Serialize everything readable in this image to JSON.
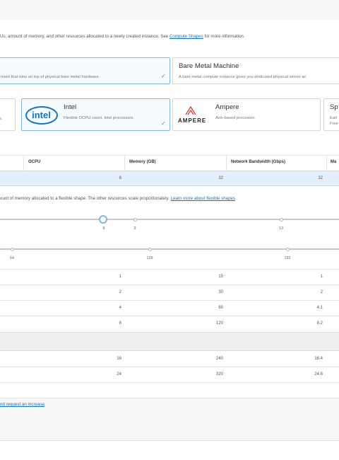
{
  "intro": {
    "text": "Us, amount of memory, and other resources allocated to a newly created instance. See ",
    "link": "Compute Shapes",
    "suffix": " for more information."
  },
  "instance_types": [
    {
      "desc": "ment that runs on top of physical bare metal hardware.",
      "selected": true
    },
    {
      "title": "Bare Metal Machine",
      "desc": "A bare metal compute instance gives you dedicated physical server ac",
      "selected": false
    }
  ],
  "processors": {
    "left_fragment": "s.",
    "intel": {
      "logo": "intel",
      "title": "Intel",
      "desc": "Flexible OCPU count. Intel processors.",
      "selected": true
    },
    "ampere": {
      "logo": "AMPERE",
      "title": "Ampere",
      "desc": "Arm-based processor."
    },
    "spark": {
      "title": "Sp",
      "desc1": "Earl",
      "desc2": "Free"
    }
  },
  "shape_table": {
    "headers": [
      "OCPU",
      "Memory (GB)",
      "Network Bandwidth (Gbps)",
      "Ma"
    ],
    "selected_row": [
      "8",
      "32",
      "32"
    ]
  },
  "flex_note": {
    "text": "ount of memory allocated to a flexible shape. The other resources scale proportionately. ",
    "link": "Learn more about flexible shapes"
  },
  "ocpu_slider": {
    "ticks": [
      "8",
      "9",
      "13"
    ],
    "value": "8"
  },
  "memory_slider": {
    "ticks": [
      "64",
      "128",
      "192"
    ]
  },
  "resource_rows": [
    [
      "1",
      "15",
      "1"
    ],
    [
      "2",
      "30",
      "2"
    ],
    [
      "4",
      "60",
      "4.1"
    ],
    [
      "8",
      "120",
      "8.2"
    ],
    [
      "16",
      "240",
      "16.4"
    ],
    [
      "24",
      "320",
      "24.6"
    ]
  ],
  "footer_link": "nd request an increase",
  "footer_period": ".",
  "colors": {
    "accent": "#1a73b8",
    "selection": "#7fb7df"
  }
}
